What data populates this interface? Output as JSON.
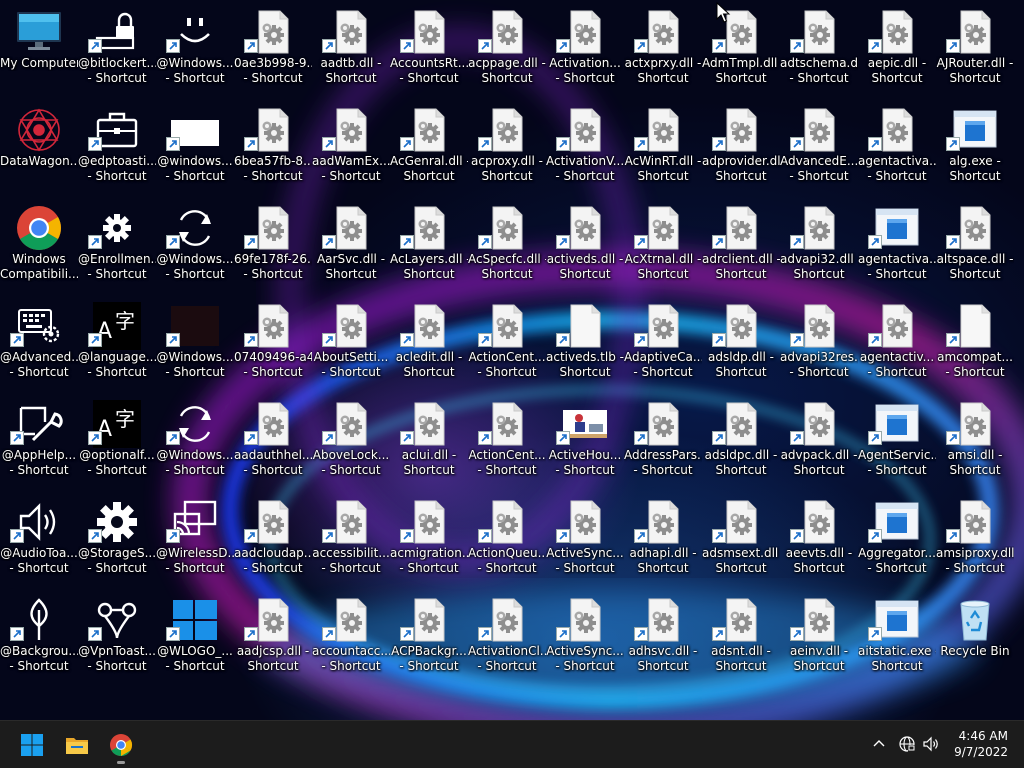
{
  "desktop": {
    "columns": [
      [
        {
          "l1": "My Computer",
          "l2": "",
          "glyph": "monitor",
          "sc": false
        },
        {
          "l1": "DataWagon...",
          "l2": "",
          "glyph": "mandala",
          "sc": false
        },
        {
          "l1": "Windows",
          "l2": "Compatibili...",
          "glyph": "chrome",
          "sc": false
        },
        {
          "l1": "@Advanced...",
          "l2": "- Shortcut",
          "glyph": "keyboard-gear",
          "sc": true
        },
        {
          "l1": "@AppHelp...",
          "l2": "- Shortcut",
          "glyph": "pen-wrench",
          "sc": true
        },
        {
          "l1": "@AudioToa...",
          "l2": "- Shortcut",
          "glyph": "speaker",
          "sc": true
        },
        {
          "l1": "@Backgrou...",
          "l2": "- Shortcut",
          "glyph": "pin",
          "sc": true
        }
      ],
      [
        {
          "l1": "@bitlockert...",
          "l2": "- Shortcut",
          "glyph": "lock-drive",
          "sc": true
        },
        {
          "l1": "@edptoasti...",
          "l2": "- Shortcut",
          "glyph": "briefcase",
          "sc": true
        },
        {
          "l1": "@Enrollmen...",
          "l2": "- Shortcut",
          "glyph": "gear-small",
          "sc": true
        },
        {
          "l1": "@language...",
          "l2": "- Shortcut",
          "glyph": "language",
          "sc": true
        },
        {
          "l1": "@optionalf...",
          "l2": "- Shortcut",
          "glyph": "language",
          "sc": true
        },
        {
          "l1": "@StorageS...",
          "l2": "- Shortcut",
          "glyph": "gear-big",
          "sc": true
        },
        {
          "l1": "@VpnToast...",
          "l2": "- Shortcut",
          "glyph": "vpn",
          "sc": true
        }
      ],
      [
        {
          "l1": "@Windows...",
          "l2": "- Shortcut",
          "glyph": "smiley",
          "sc": true
        },
        {
          "l1": "@windows...",
          "l2": "- Shortcut",
          "glyph": "white-rect",
          "sc": true
        },
        {
          "l1": "@Windows...",
          "l2": "- Shortcut",
          "glyph": "sync",
          "sc": true
        },
        {
          "l1": "@Windows...",
          "l2": "- Shortcut",
          "glyph": "dark-rect",
          "sc": true
        },
        {
          "l1": "@Windows...",
          "l2": "- Shortcut",
          "glyph": "sync",
          "sc": true
        },
        {
          "l1": "@WirelessD...",
          "l2": "- Shortcut",
          "glyph": "cast",
          "sc": true
        },
        {
          "l1": "@WLOGO_...",
          "l2": "- Shortcut",
          "glyph": "windows-logo",
          "sc": true
        }
      ],
      [
        {
          "l1": "0ae3b998-9...",
          "l2": "- Shortcut",
          "glyph": "dll",
          "sc": true
        },
        {
          "l1": "6bea57fb-8...",
          "l2": "- Shortcut",
          "glyph": "dll",
          "sc": true
        },
        {
          "l1": "69fe178f-26...",
          "l2": "- Shortcut",
          "glyph": "dll",
          "sc": true
        },
        {
          "l1": "07409496-a4...",
          "l2": "- Shortcut",
          "glyph": "dll",
          "sc": true
        },
        {
          "l1": "aadauthhel...",
          "l2": "- Shortcut",
          "glyph": "dll",
          "sc": true
        },
        {
          "l1": "aadcloudap...",
          "l2": "- Shortcut",
          "glyph": "dll",
          "sc": true
        },
        {
          "l1": "aadjcsp.dll -",
          "l2": "Shortcut",
          "glyph": "dll",
          "sc": true
        }
      ],
      [
        {
          "l1": "aadtb.dll -",
          "l2": "Shortcut",
          "glyph": "dll",
          "sc": true
        },
        {
          "l1": "aadWamEx...",
          "l2": "- Shortcut",
          "glyph": "dll",
          "sc": true
        },
        {
          "l1": "AarSvc.dll -",
          "l2": "Shortcut",
          "glyph": "dll",
          "sc": true
        },
        {
          "l1": "AboutSetti...",
          "l2": "- Shortcut",
          "glyph": "dll",
          "sc": true
        },
        {
          "l1": "AboveLock...",
          "l2": "- Shortcut",
          "glyph": "dll",
          "sc": true
        },
        {
          "l1": "accessibilit...",
          "l2": "- Shortcut",
          "glyph": "dll",
          "sc": true
        },
        {
          "l1": "accountacc...",
          "l2": "- Shortcut",
          "glyph": "dll",
          "sc": true
        }
      ],
      [
        {
          "l1": "AccountsRt...",
          "l2": "- Shortcut",
          "glyph": "dll",
          "sc": true
        },
        {
          "l1": "AcGenral.dll -",
          "l2": "Shortcut",
          "glyph": "dll",
          "sc": true
        },
        {
          "l1": "AcLayers.dll -",
          "l2": "Shortcut",
          "glyph": "dll",
          "sc": true
        },
        {
          "l1": "acledit.dll -",
          "l2": "Shortcut",
          "glyph": "dll",
          "sc": true
        },
        {
          "l1": "aclui.dll -",
          "l2": "Shortcut",
          "glyph": "dll",
          "sc": true
        },
        {
          "l1": "acmigration...",
          "l2": "- Shortcut",
          "glyph": "dll",
          "sc": true
        },
        {
          "l1": "ACPBackgr...",
          "l2": "- Shortcut",
          "glyph": "dll",
          "sc": true
        }
      ],
      [
        {
          "l1": "acppage.dll -",
          "l2": "Shortcut",
          "glyph": "dll",
          "sc": true
        },
        {
          "l1": "acproxy.dll -",
          "l2": "Shortcut",
          "glyph": "dll",
          "sc": true
        },
        {
          "l1": "AcSpecfc.dll -",
          "l2": "Shortcut",
          "glyph": "dll",
          "sc": true
        },
        {
          "l1": "ActionCent...",
          "l2": "- Shortcut",
          "glyph": "dll",
          "sc": true
        },
        {
          "l1": "ActionCent...",
          "l2": "- Shortcut",
          "glyph": "dll",
          "sc": true
        },
        {
          "l1": "ActionQueu...",
          "l2": "- Shortcut",
          "glyph": "dll",
          "sc": true
        },
        {
          "l1": "ActivationCl...",
          "l2": "- Shortcut",
          "glyph": "dll",
          "sc": true
        }
      ],
      [
        {
          "l1": "Activation...",
          "l2": "- Shortcut",
          "glyph": "dll",
          "sc": true
        },
        {
          "l1": "ActivationV...",
          "l2": "- Shortcut",
          "glyph": "dll",
          "sc": true
        },
        {
          "l1": "activeds.dll -",
          "l2": "Shortcut",
          "glyph": "dll",
          "sc": true
        },
        {
          "l1": "activeds.tlb -",
          "l2": "Shortcut",
          "glyph": "blank-file",
          "sc": true
        },
        {
          "l1": "ActiveHou...",
          "l2": "- Shortcut",
          "glyph": "photo",
          "sc": true
        },
        {
          "l1": "ActiveSync...",
          "l2": "- Shortcut",
          "glyph": "dll",
          "sc": true
        },
        {
          "l1": "ActiveSync...",
          "l2": "- Shortcut",
          "glyph": "dll",
          "sc": true
        }
      ],
      [
        {
          "l1": "actxprxy.dll -",
          "l2": "Shortcut",
          "glyph": "dll",
          "sc": true
        },
        {
          "l1": "AcWinRT.dll -",
          "l2": "Shortcut",
          "glyph": "dll",
          "sc": true
        },
        {
          "l1": "AcXtrnal.dll -",
          "l2": "Shortcut",
          "glyph": "dll",
          "sc": true
        },
        {
          "l1": "AdaptiveCa...",
          "l2": "- Shortcut",
          "glyph": "dll",
          "sc": true
        },
        {
          "l1": "AddressPars...",
          "l2": "- Shortcut",
          "glyph": "dll",
          "sc": true
        },
        {
          "l1": "adhapi.dll -",
          "l2": "Shortcut",
          "glyph": "dll",
          "sc": true
        },
        {
          "l1": "adhsvc.dll -",
          "l2": "Shortcut",
          "glyph": "dll",
          "sc": true
        }
      ],
      [
        {
          "l1": "AdmTmpl.dll -",
          "l2": "Shortcut",
          "glyph": "dll",
          "sc": true
        },
        {
          "l1": "adprovider.dll -",
          "l2": "Shortcut",
          "glyph": "dll",
          "sc": true
        },
        {
          "l1": "adrclient.dll -",
          "l2": "Shortcut",
          "glyph": "dll",
          "sc": true
        },
        {
          "l1": "adsldp.dll -",
          "l2": "Shortcut",
          "glyph": "dll",
          "sc": true
        },
        {
          "l1": "adsldpc.dll -",
          "l2": "Shortcut",
          "glyph": "dll",
          "sc": true
        },
        {
          "l1": "adsmsext.dll -",
          "l2": "Shortcut",
          "glyph": "dll",
          "sc": true
        },
        {
          "l1": "adsnt.dll -",
          "l2": "Shortcut",
          "glyph": "dll",
          "sc": true
        }
      ],
      [
        {
          "l1": "adtschema.dll",
          "l2": "- Shortcut",
          "glyph": "dll",
          "sc": true
        },
        {
          "l1": "AdvancedE...",
          "l2": "- Shortcut",
          "glyph": "dll",
          "sc": true
        },
        {
          "l1": "advapi32.dll -",
          "l2": "Shortcut",
          "glyph": "dll",
          "sc": true
        },
        {
          "l1": "advapi32res...",
          "l2": "- Shortcut",
          "glyph": "dll",
          "sc": true
        },
        {
          "l1": "advpack.dll -",
          "l2": "Shortcut",
          "glyph": "dll",
          "sc": true
        },
        {
          "l1": "aeevts.dll -",
          "l2": "Shortcut",
          "glyph": "dll",
          "sc": true
        },
        {
          "l1": "aeinv.dll -",
          "l2": "Shortcut",
          "glyph": "dll",
          "sc": true
        }
      ],
      [
        {
          "l1": "aepic.dll -",
          "l2": "Shortcut",
          "glyph": "dll",
          "sc": true
        },
        {
          "l1": "agentactiva...",
          "l2": "- Shortcut",
          "glyph": "dll",
          "sc": true
        },
        {
          "l1": "agentactiva...",
          "l2": "- Shortcut",
          "glyph": "app-window",
          "sc": true
        },
        {
          "l1": "agentactiv...",
          "l2": "- Shortcut",
          "glyph": "dll",
          "sc": true
        },
        {
          "l1": "AgentServic...",
          "l2": "- Shortcut",
          "glyph": "app-window",
          "sc": true
        },
        {
          "l1": "Aggregator...",
          "l2": "- Shortcut",
          "glyph": "app-window",
          "sc": true
        },
        {
          "l1": "aitstatic.exe -",
          "l2": "Shortcut",
          "glyph": "app-window",
          "sc": true
        }
      ],
      [
        {
          "l1": "AJRouter.dll -",
          "l2": "Shortcut",
          "glyph": "dll",
          "sc": true
        },
        {
          "l1": "alg.exe -",
          "l2": "Shortcut",
          "glyph": "app-window",
          "sc": true
        },
        {
          "l1": "altspace.dll -",
          "l2": "Shortcut",
          "glyph": "dll",
          "sc": true
        },
        {
          "l1": "amcompat...",
          "l2": "- Shortcut",
          "glyph": "blank-file",
          "sc": true
        },
        {
          "l1": "amsi.dll -",
          "l2": "Shortcut",
          "glyph": "dll",
          "sc": true
        },
        {
          "l1": "amsiproxy.dll",
          "l2": "- Shortcut",
          "glyph": "dll",
          "sc": true
        },
        {
          "l1": "Recycle Bin",
          "l2": "",
          "glyph": "recycle-bin",
          "sc": false
        }
      ]
    ]
  },
  "taskbar": {
    "clock_time": "4:46 AM",
    "clock_date": "9/7/2022",
    "pinned": [
      {
        "name": "start-button",
        "icon": "windows-logo-icon"
      },
      {
        "name": "file-explorer-button",
        "icon": "folder-icon"
      },
      {
        "name": "chrome-button",
        "icon": "chrome-icon"
      }
    ],
    "tray": [
      "chevron-up-icon",
      "network-icon",
      "volume-icon"
    ]
  },
  "colors": {
    "taskbar_bg": "#1c1c1c",
    "accent_blue": "#1e90ff"
  }
}
